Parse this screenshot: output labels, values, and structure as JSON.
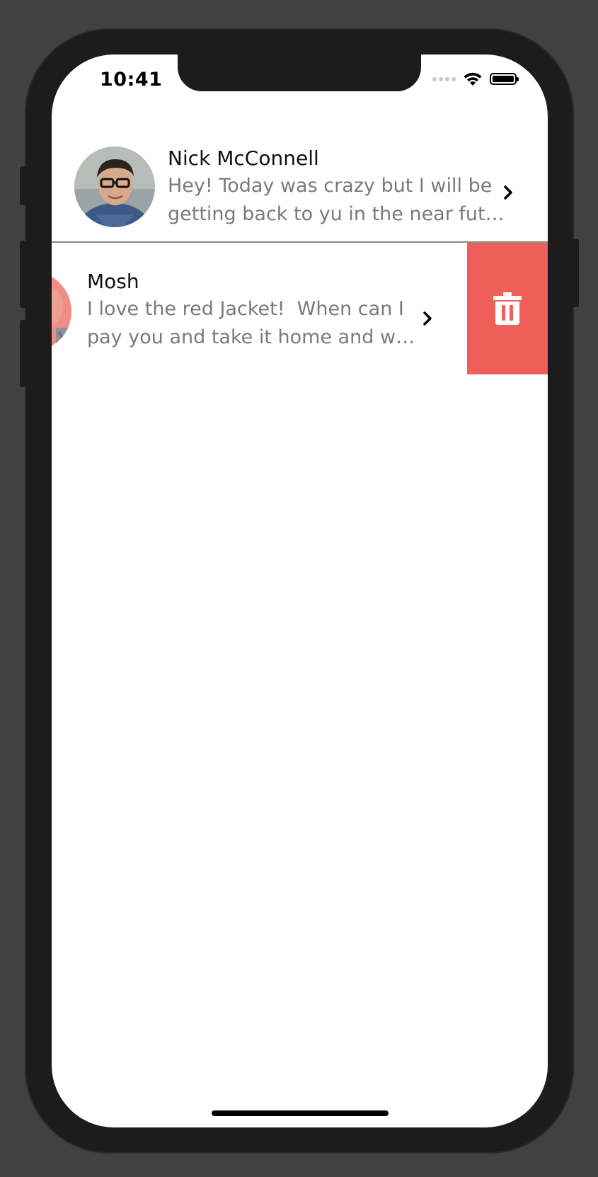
{
  "status_bar": {
    "time": "10:41",
    "icons": [
      "cellular-dots-icon",
      "wifi-icon",
      "battery-icon"
    ]
  },
  "messages": [
    {
      "name": "Nick McConnell",
      "preview_line1": "Hey! Today was crazy but I will be",
      "preview_line2": "getting back to yu in the near fut…"
    },
    {
      "name": "Mosh",
      "preview_line1": "I love the red Jacket!  When can I",
      "preview_line2": "pay you and take it home and w…",
      "swiped": true
    }
  ],
  "delete_action": {
    "icon": "trash-icon",
    "color": "#ED5F58"
  },
  "colors": {
    "name_text": "#111111",
    "preview_text": "#7A7A7A",
    "separator": "#8A8A8A"
  }
}
